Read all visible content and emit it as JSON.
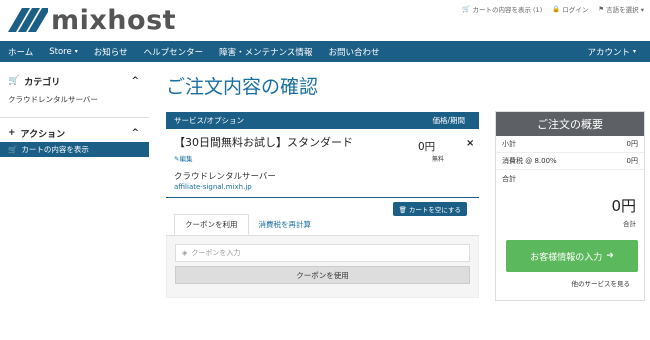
{
  "brand": {
    "name": "mixhost"
  },
  "toplinks": [
    {
      "icon": "cart-icon",
      "label": "カートの内容を表示 (1)"
    },
    {
      "icon": "lock-icon",
      "label": "ログイン"
    },
    {
      "icon": "flag-icon",
      "label": "言語を選択 ▾"
    }
  ],
  "nav": {
    "items": [
      "ホーム",
      "Store",
      "お知らせ",
      "ヘルプセンター",
      "障害・メンテナンス情報",
      "お問い合わせ"
    ],
    "store_caret": "▾",
    "account": "アカウント",
    "account_caret": "▾"
  },
  "sidebar": {
    "category_title": "カテゴリ",
    "category_item": "クラウドレンタルサーバー",
    "action_title": "アクション",
    "action_item": "カートの内容を表示",
    "collapse_glyph": "^"
  },
  "page_title": "ご注文内容の確認",
  "cart": {
    "col_service": "サービス/オプション",
    "col_period": "価格/期間",
    "item": {
      "name": "【30日間無料お試し】スタンダード",
      "edit_label": "編集",
      "product": "クラウドレンタルサーバー",
      "domain": "affiliate-signal.mixh.jp",
      "price": "0円",
      "cycle": "無料",
      "remove": "×"
    },
    "empty_label": "カートを空にする"
  },
  "coupon": {
    "tab_coupon": "クーポンを利用",
    "tab_tax": "消費税を再計算",
    "placeholder": "クーポンを入力",
    "apply_label": "クーポンを使用"
  },
  "summary": {
    "title": "ご注文の概要",
    "subtotal_label": "小計",
    "subtotal_value": "0円",
    "tax_label": "消費税 @ 8.00%",
    "tax_value": "0円",
    "total_label": "合計",
    "total_value": "0円",
    "total_sub": "合計",
    "checkout_label": "お客様情報の入力",
    "more_label": "他のサービスを見る"
  },
  "colors": {
    "nav": "#1b5e86",
    "accent": "#1b6fa0",
    "checkout": "#5cb85c",
    "summary_head": "#5d6064"
  }
}
